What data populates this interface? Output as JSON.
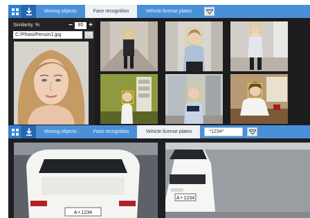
{
  "top_toolbar": {
    "grid_icon": "grid-icon",
    "download_icon": "download-icon",
    "tabs": [
      {
        "label": "Moving objects",
        "active": false
      },
      {
        "label": "Face recognition",
        "active": true
      },
      {
        "label": "Vehicle license plates",
        "active": false
      }
    ],
    "tool_icon": "image-search-icon"
  },
  "face_search": {
    "similarity_label": "Similarity, %",
    "minus": "−",
    "similarity_value": "85",
    "plus": "+",
    "photo_path": "C:/Photo/Person1.jpg",
    "browse_label": "..."
  },
  "results": [
    {
      "scene": "corridor",
      "detected": true
    },
    {
      "scene": "hallway",
      "detected": true
    },
    {
      "scene": "lobby",
      "detected": true
    },
    {
      "scene": "office-green",
      "detected": true
    },
    {
      "scene": "office-window",
      "detected": true
    },
    {
      "scene": "office-desk",
      "detected": true
    }
  ],
  "mid_toolbar": {
    "grid_icon": "grid-icon",
    "download_icon": "download-icon",
    "tabs": [
      {
        "label": "Moving objects",
        "active": false
      },
      {
        "label": "Face recognition",
        "active": false
      },
      {
        "label": "Vehicle license plates",
        "active": true
      }
    ],
    "plate_query": "*1234*",
    "tool_icon": "image-search-icon"
  },
  "plates": [
    {
      "plate": "A • 1234"
    },
    {
      "plate": "A • 1234"
    }
  ],
  "colors": {
    "toolbar": "#4a90d9",
    "active_tab": "#eef1f5",
    "detection_box": "#f2cf2a",
    "panel": "#1c1c1e"
  }
}
